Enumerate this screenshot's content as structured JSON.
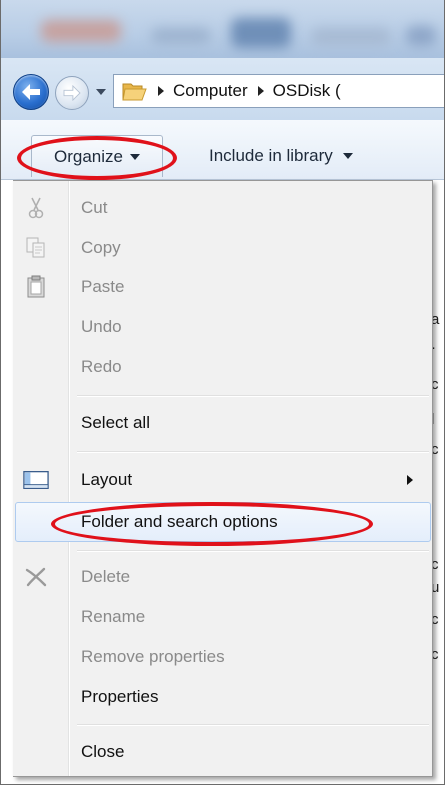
{
  "address": {
    "crumbs": [
      "Computer",
      "OSDisk ("
    ]
  },
  "toolbar": {
    "organize_label": "Organize",
    "include_label": "Include in library"
  },
  "menu": {
    "cut": "Cut",
    "copy": "Copy",
    "paste": "Paste",
    "undo": "Undo",
    "redo": "Redo",
    "select_all": "Select all",
    "layout": "Layout",
    "folder_options": "Folder and search options",
    "delete": "Delete",
    "rename": "Rename",
    "remove_properties": "Remove properties",
    "properties": "Properties",
    "close": "Close"
  },
  "colors": {
    "annotation_ring": "#e0111a",
    "highlight_border": "#aecbef",
    "disabled_text": "#8a8a8a"
  },
  "icons": [
    "back-arrow-icon",
    "forward-arrow-icon",
    "folder-icon",
    "scissors-icon",
    "copy-icon",
    "clipboard-icon",
    "layout-pane-icon",
    "delete-x-icon"
  ]
}
